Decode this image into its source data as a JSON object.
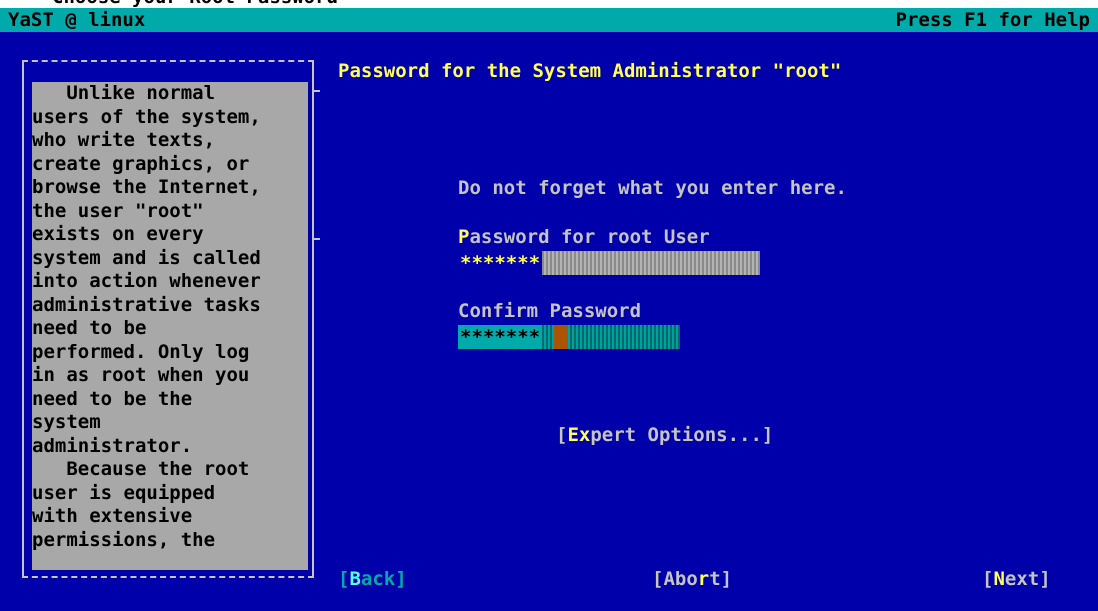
{
  "top_partial_text": "Choose your Root Password",
  "titlebar": {
    "left": "YaST @ linux",
    "right": "Press F1 for Help"
  },
  "help": {
    "text": "   Unlike normal\nusers of the system,\nwho write texts,\ncreate graphics, or\nbrowse the Internet,\nthe user \"root\"\nexists on every\nsystem and is called\ninto action whenever\nadministrative tasks\nneed to be\nperformed. Only log\nin as root when you\nneed to be the\nsystem\nadministrator.\n   Because the root\nuser is equipped\nwith extensive\npermissions, the"
  },
  "dialog": {
    "title": "Password for the System Administrator \"root\"",
    "hint": "Do not forget what you enter here.",
    "password": {
      "label_hot": "P",
      "label_rest": "assword for root User",
      "masked": "*******"
    },
    "confirm": {
      "label_hot": "",
      "label_rest": "Confirm Password",
      "masked": "*******"
    },
    "expert": {
      "pre": "[",
      "hot": "Ex",
      "post": "pert Options...]"
    }
  },
  "buttons": {
    "back": {
      "pre": "[",
      "hot": "B",
      "post": "ack]"
    },
    "abort": {
      "pre": "[Abo",
      "hot": "r",
      "post": "t]"
    },
    "next": {
      "pre": "[",
      "hot": "N",
      "post": "ext]"
    }
  },
  "colors": {
    "background": "#0000aa",
    "titlebar": "#00aaaa",
    "highlight": "#ffff55",
    "help_bg": "#a8a8a8"
  }
}
